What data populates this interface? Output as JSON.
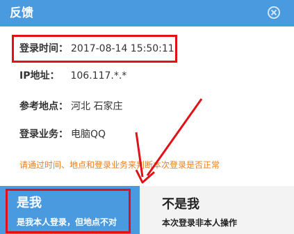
{
  "window": {
    "title": "反馈"
  },
  "fields": {
    "login_time": {
      "label": "登录时间：",
      "value": "2017-08-14 15:50:11"
    },
    "ip": {
      "label": "IP地址：",
      "value": "106.117.*.*"
    },
    "location": {
      "label": "参考地点：",
      "value": "河北 石家庄"
    },
    "service": {
      "label": "登录业务：",
      "value": "电脑QQ"
    }
  },
  "notice": "请通过时间、地点和登录业务来判断本次登录是否正常",
  "buttons": {
    "is_me": {
      "title": "是我",
      "subtitle": "是我本人登录，但地点不对"
    },
    "not_me": {
      "title": "不是我",
      "subtitle": "本次登录非本人操作"
    }
  },
  "annotations": {
    "color": "#e01218"
  },
  "colors": {
    "accent": "#4a9ae0",
    "notice": "#ec7f1c"
  }
}
